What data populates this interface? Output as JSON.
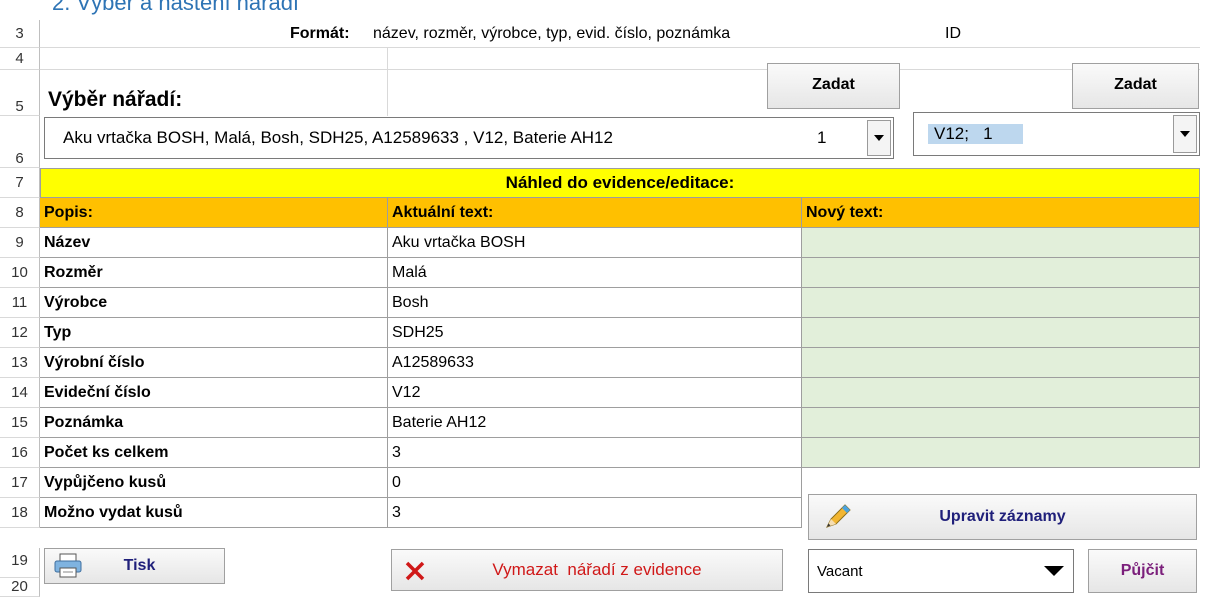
{
  "heading_partial": "2. Výběr a nastení nářadí",
  "format_label": "Formát:",
  "format_text": "název, rozměr, výrobce, typ, evid. číslo, poznámka",
  "format_id": "ID",
  "selection_label": "Výběr nářadí:",
  "zadat_button_1": "Zadat",
  "zadat_button_2": "Zadat",
  "tool_combo": {
    "value": "Aku vrtačka BOSH, Malá, Bosh, SDH25, A12589633 , V12, Baterie AH12",
    "count": "1"
  },
  "id_combo": {
    "value": "V12;   1"
  },
  "preview_title": "Náhled do evidence/editace:",
  "columns": {
    "popis": "Popis:",
    "aktualni": "Aktuální text:",
    "novy": "Nový text:"
  },
  "rows": [
    {
      "num": "9",
      "label": "Název",
      "value": "Aku vrtačka BOSH"
    },
    {
      "num": "10",
      "label": "Rozměr",
      "value": "Malá"
    },
    {
      "num": "11",
      "label": "Výrobce",
      "value": "Bosh"
    },
    {
      "num": "12",
      "label": "Typ",
      "value": "SDH25"
    },
    {
      "num": "13",
      "label": "Výrobní číslo",
      "value": "A12589633"
    },
    {
      "num": "14",
      "label": "Evideční číslo",
      "value": "V12"
    },
    {
      "num": "15",
      "label": "Poznámka",
      "value": "Baterie AH12"
    },
    {
      "num": "16",
      "label": "Počet ks celkem",
      "value": "3"
    },
    {
      "num": "17",
      "label": "Vypůjčeno kusů",
      "value": "0"
    },
    {
      "num": "18",
      "label": "Možno vydat kusů",
      "value": "3"
    }
  ],
  "row_numbers_top": [
    "3",
    "4",
    "5",
    "6",
    "7",
    "8"
  ],
  "row_numbers_bottom": [
    "19",
    "20"
  ],
  "buttons": {
    "edit": "Upravit záznamy",
    "print": "Tisk",
    "delete": "Vymazat  nářadí z evidence",
    "lend": "Půjčit"
  },
  "status_combo": {
    "value": "Vacant"
  },
  "colors": {
    "yellow": "#ffff00",
    "orange": "#ffc000",
    "green_cell": "#e2efda",
    "button_text": "#1f1f7a",
    "delete_text": "#d01818",
    "selection_highlight": "#bdd7ee"
  }
}
